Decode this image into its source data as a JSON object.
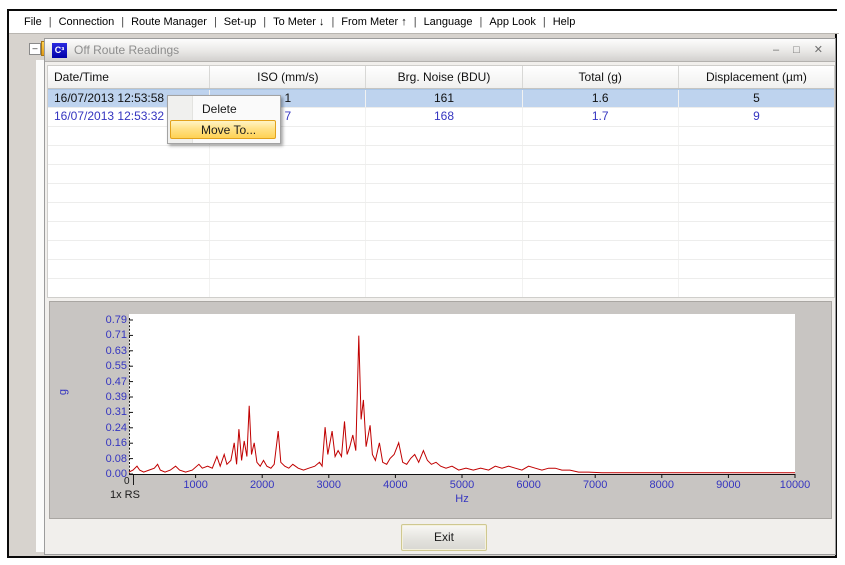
{
  "menu_bar": {
    "items": [
      "File",
      "Connection",
      "Route Manager",
      "Set-up",
      "To Meter ↓",
      "From Meter ↑",
      "Language",
      "App Look",
      "Help"
    ],
    "separator": "|"
  },
  "window": {
    "title": "Off Route Readings",
    "icon_label": "C³",
    "controls": {
      "minimize": "–",
      "maximize": "□",
      "close": "✕"
    },
    "tree_expander": "–"
  },
  "table": {
    "columns": [
      "Date/Time",
      "ISO (mm/s)",
      "Brg. Noise (BDU)",
      "Total (g)",
      "Displacement (µm)"
    ],
    "rows": [
      {
        "cells": [
          "16/07/2013 12:53:58",
          "1",
          "161",
          "1.6",
          "5"
        ],
        "selected": true,
        "blue": false
      },
      {
        "cells": [
          "16/07/2013 12:53:32",
          "7",
          "168",
          "1.7",
          "9"
        ],
        "selected": false,
        "blue": true
      }
    ],
    "empty_row_count": 10
  },
  "context_menu": {
    "items": [
      {
        "label": "Delete",
        "highlighted": false
      },
      {
        "label": "Move To...",
        "highlighted": true
      }
    ]
  },
  "chart_data": {
    "type": "line",
    "title": "",
    "xlabel": "Hz",
    "ylabel": "g",
    "xlim": [
      0,
      10000
    ],
    "ylim": [
      0,
      0.79
    ],
    "x_tick_labels": [
      "1000",
      "2000",
      "3000",
      "4000",
      "5000",
      "6000",
      "7000",
      "8000",
      "9000",
      "10000"
    ],
    "y_tick_labels": [
      "0.79",
      "0.71",
      "0.63",
      "0.55",
      "0.47",
      "0.39",
      "0.31",
      "0.24",
      "0.16",
      "0.08",
      "0.00"
    ],
    "cursor_label": "0",
    "annotation": "1x RS",
    "legend": [],
    "grid": false,
    "line_color": "#c00000",
    "series": [
      {
        "name": "spectrum",
        "points": [
          [
            0,
            0.01
          ],
          [
            60,
            0.02
          ],
          [
            120,
            0.04
          ],
          [
            160,
            0.02
          ],
          [
            220,
            0.01
          ],
          [
            300,
            0.02
          ],
          [
            380,
            0.03
          ],
          [
            430,
            0.05
          ],
          [
            470,
            0.02
          ],
          [
            540,
            0.01
          ],
          [
            620,
            0.02
          ],
          [
            700,
            0.04
          ],
          [
            760,
            0.02
          ],
          [
            850,
            0.01
          ],
          [
            950,
            0.02
          ],
          [
            1050,
            0.05
          ],
          [
            1100,
            0.03
          ],
          [
            1180,
            0.04
          ],
          [
            1250,
            0.03
          ],
          [
            1320,
            0.09
          ],
          [
            1370,
            0.04
          ],
          [
            1430,
            0.1
          ],
          [
            1470,
            0.05
          ],
          [
            1530,
            0.07
          ],
          [
            1580,
            0.16
          ],
          [
            1615,
            0.05
          ],
          [
            1650,
            0.23
          ],
          [
            1690,
            0.07
          ],
          [
            1730,
            0.17
          ],
          [
            1770,
            0.09
          ],
          [
            1805,
            0.35
          ],
          [
            1840,
            0.1
          ],
          [
            1880,
            0.16
          ],
          [
            1920,
            0.06
          ],
          [
            1970,
            0.04
          ],
          [
            2020,
            0.07
          ],
          [
            2070,
            0.04
          ],
          [
            2130,
            0.03
          ],
          [
            2180,
            0.05
          ],
          [
            2240,
            0.22
          ],
          [
            2280,
            0.06
          ],
          [
            2340,
            0.04
          ],
          [
            2400,
            0.03
          ],
          [
            2460,
            0.05
          ],
          [
            2540,
            0.03
          ],
          [
            2620,
            0.02
          ],
          [
            2700,
            0.03
          ],
          [
            2790,
            0.04
          ],
          [
            2860,
            0.06
          ],
          [
            2900,
            0.04
          ],
          [
            2945,
            0.24
          ],
          [
            2985,
            0.1
          ],
          [
            3050,
            0.22
          ],
          [
            3095,
            0.09
          ],
          [
            3140,
            0.12
          ],
          [
            3190,
            0.09
          ],
          [
            3235,
            0.27
          ],
          [
            3275,
            0.1
          ],
          [
            3315,
            0.14
          ],
          [
            3360,
            0.2
          ],
          [
            3405,
            0.12
          ],
          [
            3450,
            0.71
          ],
          [
            3485,
            0.28
          ],
          [
            3520,
            0.38
          ],
          [
            3560,
            0.14
          ],
          [
            3620,
            0.25
          ],
          [
            3655,
            0.1
          ],
          [
            3700,
            0.07
          ],
          [
            3760,
            0.16
          ],
          [
            3810,
            0.06
          ],
          [
            3870,
            0.05
          ],
          [
            3920,
            0.08
          ],
          [
            3980,
            0.1
          ],
          [
            4050,
            0.16
          ],
          [
            4110,
            0.06
          ],
          [
            4170,
            0.05
          ],
          [
            4230,
            0.08
          ],
          [
            4290,
            0.1
          ],
          [
            4350,
            0.06
          ],
          [
            4420,
            0.12
          ],
          [
            4480,
            0.07
          ],
          [
            4540,
            0.05
          ],
          [
            4610,
            0.06
          ],
          [
            4680,
            0.04
          ],
          [
            4760,
            0.03
          ],
          [
            4850,
            0.04
          ],
          [
            4950,
            0.02
          ],
          [
            5060,
            0.03
          ],
          [
            5170,
            0.02
          ],
          [
            5280,
            0.03
          ],
          [
            5400,
            0.02
          ],
          [
            5500,
            0.04
          ],
          [
            5600,
            0.03
          ],
          [
            5700,
            0.04
          ],
          [
            5800,
            0.03
          ],
          [
            5900,
            0.02
          ],
          [
            6000,
            0.04
          ],
          [
            6100,
            0.03
          ],
          [
            6200,
            0.02
          ],
          [
            6300,
            0.03
          ],
          [
            6400,
            0.03
          ],
          [
            6500,
            0.02
          ],
          [
            6620,
            0.02
          ],
          [
            6750,
            0.01
          ],
          [
            6900,
            0.01
          ],
          [
            7100,
            0.006
          ],
          [
            7400,
            0.006
          ],
          [
            7800,
            0.006
          ],
          [
            8200,
            0.006
          ],
          [
            8700,
            0.006
          ],
          [
            9200,
            0.006
          ],
          [
            9700,
            0.006
          ],
          [
            10000,
            0.006
          ]
        ]
      }
    ]
  },
  "footer": {
    "exit_label": "Exit"
  },
  "colors": {
    "selection_blue": "#bed3ee",
    "accent_blue_text": "#3535c0",
    "spectrum_red": "#c00000",
    "menu_highlight_orange": "#ffd254",
    "panel_gray": "#c8c5c2"
  }
}
